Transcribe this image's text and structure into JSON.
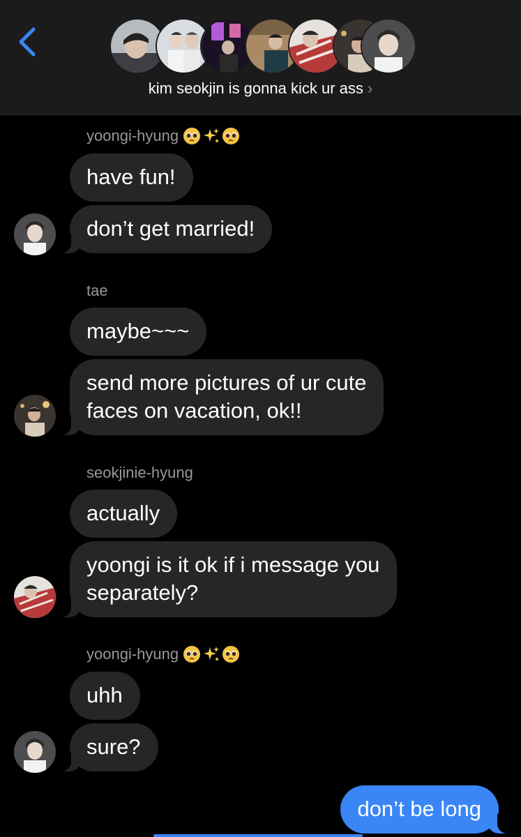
{
  "header": {
    "group_name": "kim seokjin is gonna kick ur ass",
    "chevron": "›",
    "back_icon": "chevron-left-icon",
    "accent": "#3a86f6"
  },
  "messages": [
    {
      "sender": "yoongi-hyung",
      "emoji": [
        "🥺",
        "✨",
        "🥺"
      ],
      "bubbles": [
        "have fun!",
        "don’t get married!"
      ]
    },
    {
      "sender": "tae",
      "bubbles": [
        "maybe~~~",
        "send more pictures of ur cute",
        "faces on vacation, ok!!"
      ]
    },
    {
      "sender": "seokjinie-hyung",
      "bubbles": [
        "actually",
        "yoongi is it ok if i message you",
        "separately?"
      ]
    },
    {
      "sender": "yoongi-hyung",
      "emoji": [
        "🥺",
        "✨",
        "🥺"
      ],
      "bubbles": [
        "uhh",
        "sure?"
      ]
    }
  ],
  "outgoing": {
    "text": "don’t be long"
  },
  "colors": {
    "background": "#000000",
    "incoming_bubble": "#262628",
    "outgoing_bubble": "#3a86f6",
    "sender_label": "#98989e"
  }
}
